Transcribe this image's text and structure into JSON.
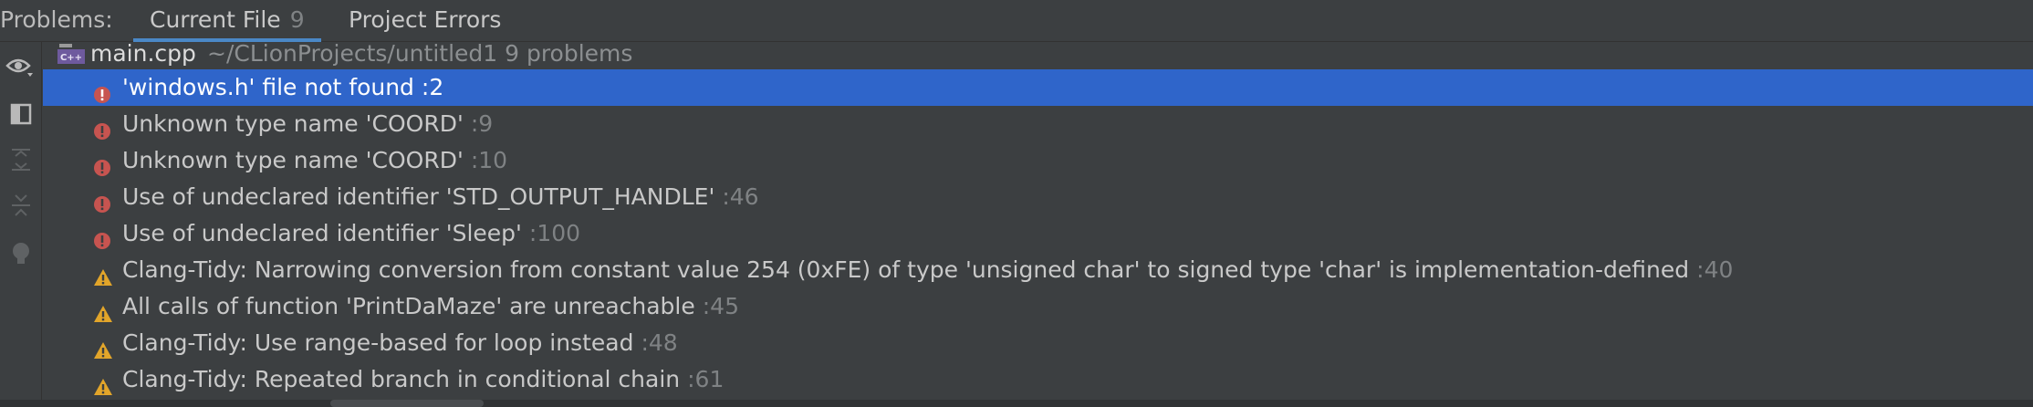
{
  "tabs": {
    "title": "Problems:",
    "items": [
      {
        "label": "Current File",
        "count": "9",
        "active": true
      },
      {
        "label": "Project Errors",
        "count": "",
        "active": false
      }
    ]
  },
  "tools": [
    {
      "icon": "eye-icon"
    },
    {
      "icon": "panel-toggle-icon"
    },
    {
      "icon": "expand-all-icon"
    },
    {
      "icon": "collapse-all-icon"
    },
    {
      "icon": "lightbulb-icon"
    }
  ],
  "file": {
    "icon": "cpp-file-icon",
    "icon_label": "C++",
    "name": "main.cpp",
    "path": "~/CLionProjects/untitled1  9 problems"
  },
  "problems": [
    {
      "severity": "error",
      "message": "'windows.h' file not found",
      "line": ":2",
      "selected": true
    },
    {
      "severity": "error",
      "message": "Unknown type name 'COORD'",
      "line": ":9",
      "selected": false
    },
    {
      "severity": "error",
      "message": "Unknown type name 'COORD'",
      "line": ":10",
      "selected": false
    },
    {
      "severity": "error",
      "message": "Use of undeclared identifier 'STD_OUTPUT_HANDLE'",
      "line": ":46",
      "selected": false
    },
    {
      "severity": "error",
      "message": "Use of undeclared identifier 'Sleep'",
      "line": ":100",
      "selected": false
    },
    {
      "severity": "warning",
      "message": "Clang-Tidy: Narrowing conversion from constant value 254 (0xFE) of type 'unsigned char' to signed type 'char' is implementation-defined",
      "line": ":40",
      "selected": false
    },
    {
      "severity": "warning",
      "message": "All calls of function 'PrintDaMaze' are unreachable",
      "line": ":45",
      "selected": false
    },
    {
      "severity": "warning",
      "message": "Clang-Tidy: Use range-based for loop instead",
      "line": ":48",
      "selected": false
    },
    {
      "severity": "warning",
      "message": "Clang-Tidy: Repeated branch in conditional chain",
      "line": ":61",
      "selected": false
    }
  ],
  "colors": {
    "error": "#c75450",
    "warning": "#e2a52a",
    "selection": "#2f65ca",
    "accent": "#4a88c7"
  }
}
